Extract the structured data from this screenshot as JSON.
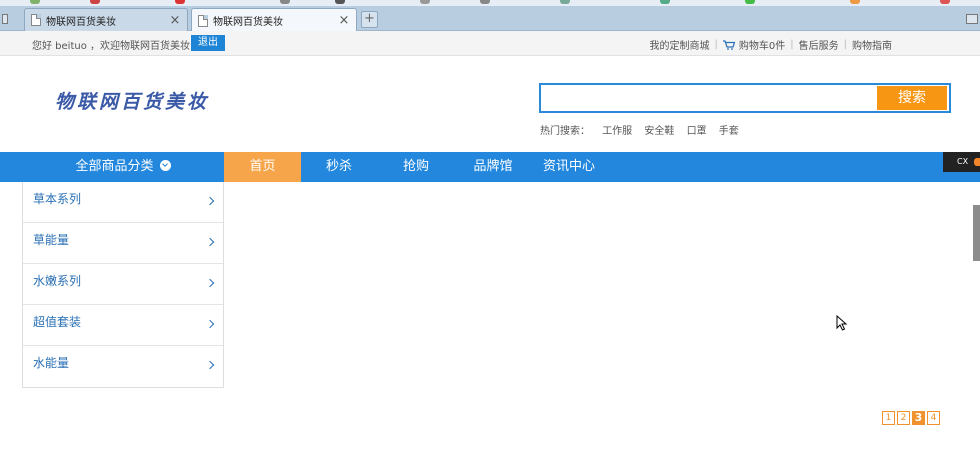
{
  "browser": {
    "tabs": [
      {
        "title": "物联网百货美妆",
        "active": false
      },
      {
        "title": "物联网百货美妆",
        "active": true
      }
    ],
    "new_tab_label": "+",
    "close_glyph": "×"
  },
  "topbar": {
    "greeting": "您好 beituo ，欢迎物联网百货美妆!",
    "logout_label": "退出",
    "links": [
      "我的定制商城",
      "购物车0件",
      "售后服务",
      "购物指南"
    ]
  },
  "header": {
    "logo_text": "物联网百货美妆",
    "search": {
      "value": "",
      "button_label": "搜索"
    },
    "hot_search": {
      "label": "热门搜索：",
      "terms": [
        "工作服",
        "安全鞋",
        "口罩",
        "手套"
      ]
    }
  },
  "nav": {
    "all_categories_label": "全部商品分类",
    "items": [
      "首页",
      "秒杀",
      "抢购",
      "品牌馆",
      "资讯中心"
    ],
    "active_index": 0
  },
  "sidebar": {
    "categories": [
      "草本系列",
      "草能量",
      "水嫩系列",
      "超值套装",
      "水能量"
    ]
  },
  "overlay": {
    "cx_label": "CX"
  },
  "pager": {
    "pages": [
      "1",
      "2",
      "3",
      "4"
    ],
    "current": "3"
  },
  "colors": {
    "nav_blue": "#2388dd",
    "nav_active": "#f7a54a",
    "search_button": "#f79613",
    "pager_orange": "#f0922e",
    "logo_blue": "#3a59a6"
  }
}
